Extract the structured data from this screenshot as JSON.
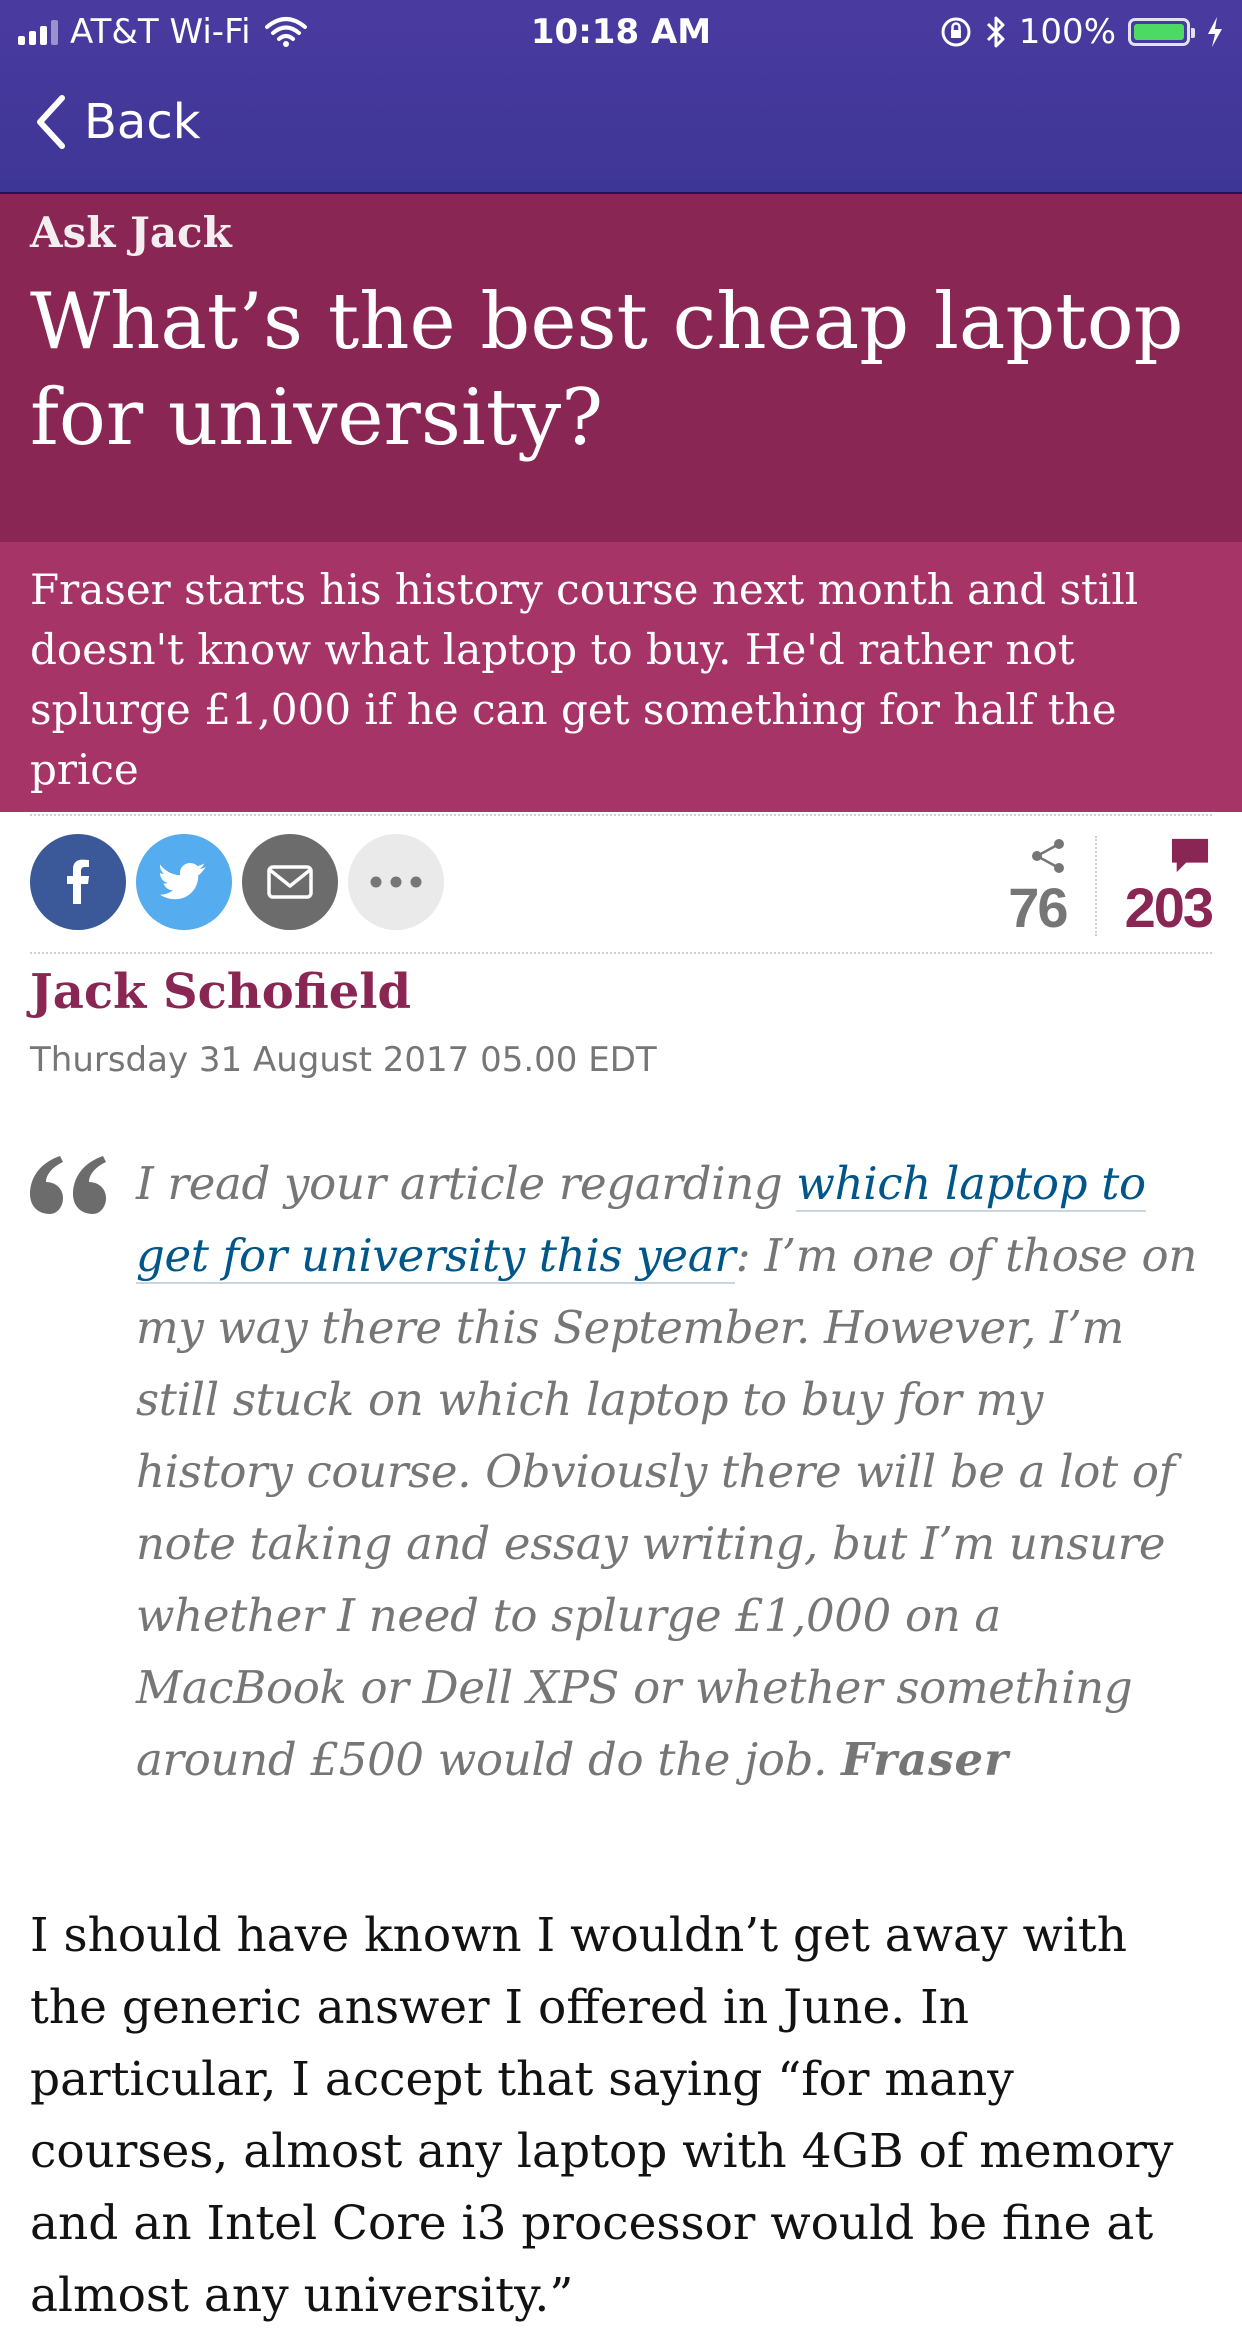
{
  "status_bar": {
    "carrier": "AT&T Wi-Fi",
    "time": "10:18 AM",
    "battery": "100%",
    "battery_level": 1.0
  },
  "nav": {
    "back_label": "Back"
  },
  "article": {
    "kicker": "Ask Jack",
    "headline": "What’s the best cheap laptop for university?",
    "standfirst": "Fraser starts his history course next month and still doesn't know what laptop to buy. He'd rather not splurge £1,000 if he can get something for half the price",
    "share_count": "76",
    "comment_count": "203",
    "author": "Jack Schofield",
    "date": "Thursday 31 August 2017 05.00 EDT",
    "quote": {
      "intro": "I read your article regarding ",
      "link_text": "which laptop to get for university this year",
      "rest": ": I’m one of those on my way there this September. However, I’m still stuck on which laptop to buy for my history course. Obviously there will be a lot of note taking and essay writing, but I’m unsure whether I need to splurge £1,000 on a MacBook or Dell XPS or whether something around £500 would do the job. ",
      "signature": "Fraser"
    },
    "body": "I should have known I wouldn’t get away with the generic answer I offered in June. In particular, I accept that saying “for many courses, almost any laptop with 4GB of memory and an Intel Core i3 processor would be fine at almost any university.”"
  },
  "share_buttons": [
    "facebook-icon",
    "twitter-icon",
    "email-icon",
    "more-icon"
  ],
  "colors": {
    "nav_bg": "#3e3696",
    "header_bg": "#8a2653",
    "standfirst_bg": "#a73467",
    "link": "#005689",
    "facebook": "#3b5998",
    "twitter": "#55acee",
    "email": "#6c6c6c"
  }
}
